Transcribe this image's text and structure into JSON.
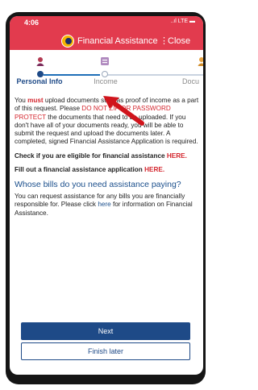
{
  "status_bar": {
    "time": "4:06",
    "icons": "..ıl LTE ▬"
  },
  "header": {
    "title": "Financial Assistance",
    "kebab": "⋮",
    "close": "Close"
  },
  "steps": [
    {
      "label": "Personal Info",
      "icon": "person-icon"
    },
    {
      "label": "Income",
      "icon": "document-icon"
    },
    {
      "label": "Docu",
      "icon": "person-icon"
    }
  ],
  "notice": {
    "p1_a": "You ",
    "p1_must": "must",
    "p1_b": " upload documents such as proof of income as a part of this request. Please ",
    "p1_red": "DO NOT ZIP OR PASSWORD PROTECT",
    "p1_c": " the documents that need to be uploaded. If you don't have all of your documents ready, you will be able to submit the request and upload the documents later. A completed, signed Financial Assistance Application is required.",
    "check_a": "Check if you are eligible for financial assistance ",
    "check_here": "HERE.",
    "fill_a": "Fill out a financial assistance application ",
    "fill_here": "HERE."
  },
  "section": {
    "title": "Whose bills do you need assistance paying?",
    "text_a": "You can request assistance for any bills you are financially responsible for. Please click ",
    "link": "here",
    "text_b": " for information on Financial Assistance."
  },
  "buttons": {
    "next": "Next",
    "finish": "Finish later"
  },
  "colors": {
    "header_red": "#e23b4e",
    "primary_blue": "#1e4a87",
    "alert_red": "#d4272f"
  }
}
